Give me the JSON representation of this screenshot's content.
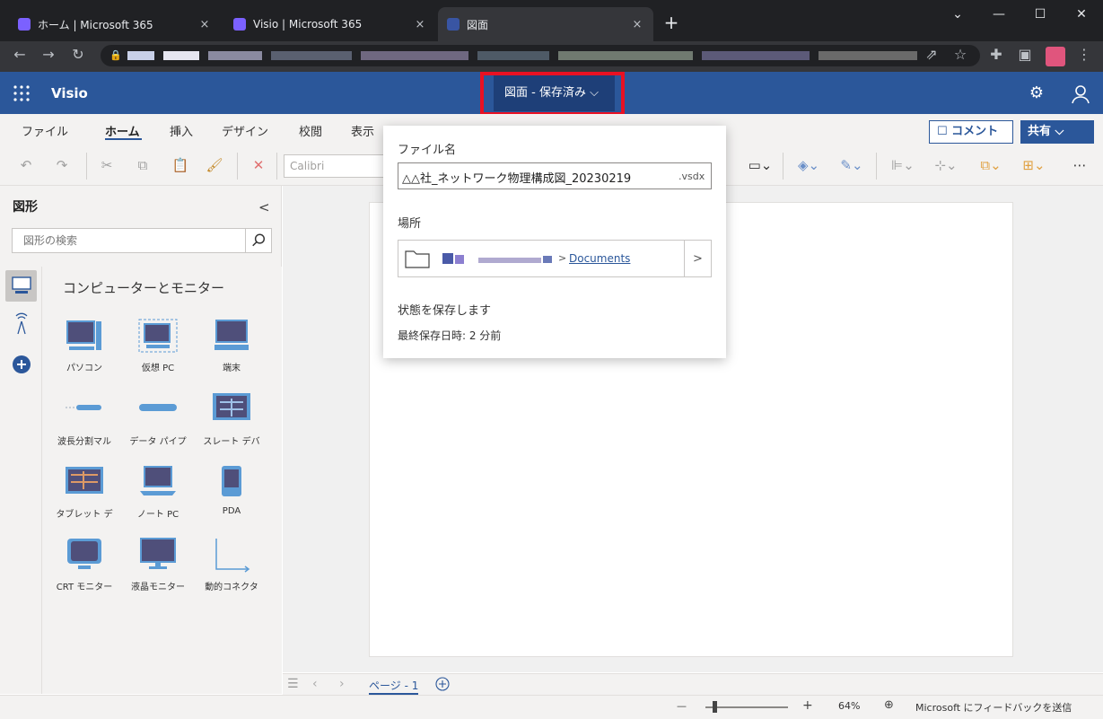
{
  "browser": {
    "tabs": [
      {
        "title": "ホーム | Microsoft 365",
        "close": "×"
      },
      {
        "title": "Visio | Microsoft 365",
        "close": "×"
      },
      {
        "title": "図面",
        "close": "×"
      }
    ],
    "new_tab": "+",
    "window_buttons": {
      "minimize": "⌄",
      "min": "—",
      "max": "☐",
      "close": "✕"
    }
  },
  "header": {
    "app_name": "Visio",
    "title_button": "図面 - 保存済み ⌵"
  },
  "ribbon": {
    "tabs": [
      "ファイル",
      "ホーム",
      "挿入",
      "デザイン",
      "校閲",
      "表示"
    ],
    "selected_tab": "ホーム",
    "comment_button": "☐ コメント",
    "share_button": "共有 ⌵",
    "font_name": "Calibri"
  },
  "shapes_pane": {
    "title": "図形",
    "collapse": "<",
    "search_placeholder": "図形の検索",
    "stencil_title": "コンピューターとモニター",
    "shapes": [
      {
        "label": "パソコン",
        "icon": "pc-icon"
      },
      {
        "label": "仮想 PC",
        "icon": "virtual-pc-icon"
      },
      {
        "label": "端末",
        "icon": "terminal-icon"
      },
      {
        "label": "波長分割マル",
        "icon": "wdm-icon"
      },
      {
        "label": "データ パイプ",
        "icon": "data-pipe-icon"
      },
      {
        "label": "スレート デバ",
        "icon": "slate-device-icon"
      },
      {
        "label": "タブレット デ",
        "icon": "tablet-icon"
      },
      {
        "label": "ノート PC",
        "icon": "laptop-icon"
      },
      {
        "label": "PDA",
        "icon": "pda-icon"
      },
      {
        "label": "CRT モニター",
        "icon": "crt-monitor-icon"
      },
      {
        "label": "液晶モニター",
        "icon": "lcd-monitor-icon"
      },
      {
        "label": "動的コネクタ",
        "icon": "dynamic-connector-icon"
      }
    ]
  },
  "file_popup": {
    "filename_label": "ファイル名",
    "filename_value": "△△社_ネットワーク物理構成図_20230219",
    "extension": ".vsdx",
    "location_label": "場所",
    "location_chevron": ">",
    "location_folder": "Documents",
    "location_next": ">",
    "save_state": "状態を保存します",
    "last_saved": "最終保存日時: 2 分前"
  },
  "page_nav": {
    "page_tab": "ページ - 1"
  },
  "status": {
    "zoom_minus": "—",
    "zoom_plus": "+",
    "zoom": "64%",
    "feedback": "Microsoft にフィードバックを送信"
  },
  "colors": {
    "brand": "#2b579a",
    "highlight": "#e81123",
    "shape_fill": "#4f4f7a",
    "shape_accent": "#5b9bd5"
  }
}
